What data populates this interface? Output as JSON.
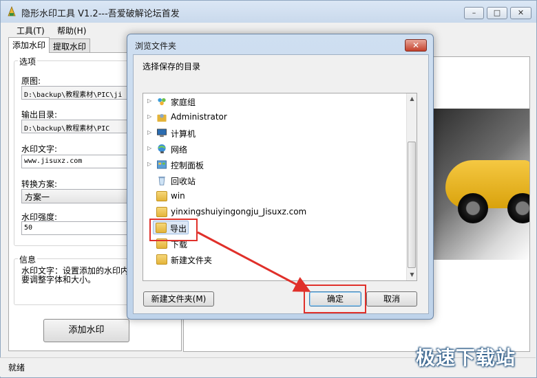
{
  "window": {
    "title": "隐形水印工具 V1.2---吾爱破解论坛首发",
    "controls": {
      "minimize": "–",
      "maximize": "□",
      "close": "✕"
    }
  },
  "menu": {
    "tools": "工具(T)",
    "help": "帮助(H)"
  },
  "tabs": [
    {
      "label": "添加水印"
    },
    {
      "label": "提取水印"
    }
  ],
  "options": {
    "group_title": "选项",
    "source_label": "原图:",
    "source_value": "D:\\backup\\教程素材\\PIC\\ji",
    "output_label": "输出目录:",
    "output_value": "D:\\backup\\教程素材\\PIC",
    "text_label": "水印文字:",
    "text_value": "www.jisuxz.com",
    "scheme_label": "转换方案:",
    "scheme_value": "方案一",
    "strength_label": "水印强度:",
    "strength_value": "50"
  },
  "info": {
    "group_title": "信息",
    "text": "水印文字：设置添加的水印内容，可根据需要调整字体和大小。"
  },
  "add_button": "添加水印",
  "status": "就绪",
  "brand_watermark": "极速下载站",
  "dialog": {
    "title": "浏览文件夹",
    "close": "✕",
    "prompt": "选择保存的目录",
    "items": [
      {
        "label": "家庭组",
        "icon": "homegroup-icon",
        "expandable": true
      },
      {
        "label": "Administrator",
        "icon": "user-folder-icon",
        "expandable": true
      },
      {
        "label": "计算机",
        "icon": "computer-icon",
        "expandable": true
      },
      {
        "label": "网络",
        "icon": "network-icon",
        "expandable": true
      },
      {
        "label": "控制面板",
        "icon": "control-panel-icon",
        "expandable": true
      },
      {
        "label": "回收站",
        "icon": "recycle-bin-icon",
        "expandable": false
      },
      {
        "label": "win",
        "icon": "folder-icon",
        "expandable": false
      },
      {
        "label": "yinxingshuiyingongju_Jisuxz.com",
        "icon": "folder-icon",
        "expandable": false
      },
      {
        "label": "导出",
        "icon": "folder-icon",
        "expandable": false,
        "selected": true
      },
      {
        "label": "下载",
        "icon": "folder-icon",
        "expandable": false
      },
      {
        "label": "新建文件夹",
        "icon": "folder-icon",
        "expandable": false
      }
    ],
    "new_folder_button": "新建文件夹(M)",
    "ok_button": "确定",
    "cancel_button": "取消"
  },
  "colors": {
    "annotation_red": "#e0302a",
    "selection": "#dde8f6",
    "folder_yellow": "#e4b43a"
  }
}
